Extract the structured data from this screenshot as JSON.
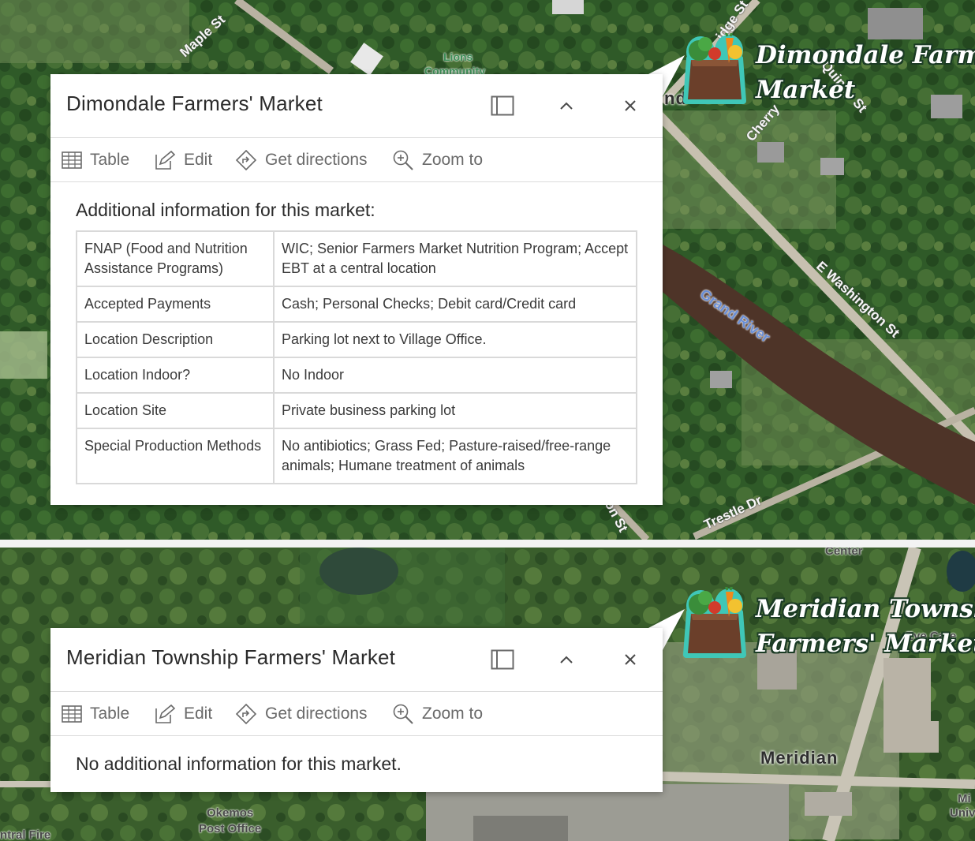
{
  "map_top": {
    "road_labels": [
      "Maple St",
      "idge St",
      "Quincy St",
      "Cherry",
      "E Washington St",
      "Trestle Dr",
      "lton St"
    ],
    "water_labels": [
      "Grand River"
    ],
    "poi_labels": [
      "Lions",
      "Community"
    ],
    "partial_place": "nd",
    "marker_label_lines": [
      "Dimondale Farmers'",
      "Market"
    ]
  },
  "popup_top": {
    "title": "Dimondale Farmers' Market",
    "toolbar": {
      "table": "Table",
      "edit": "Edit",
      "directions": "Get directions",
      "zoom": "Zoom to"
    },
    "section_title": "Additional information for this market:",
    "rows": [
      {
        "key": "FNAP (Food and Nutrition Assistance Programs)",
        "value": "WIC; Senior Farmers Market Nutrition Program; Accept EBT at a central location"
      },
      {
        "key": "Accepted Payments",
        "value": "Cash; Personal Checks; Debit card/Credit card"
      },
      {
        "key": "Location Description",
        "value": "Parking lot next to Village Office."
      },
      {
        "key": "Location Indoor?",
        "value": "No Indoor"
      },
      {
        "key": "Location Site",
        "value": "Private business parking lot"
      },
      {
        "key": "Special Production Methods",
        "value": "No antibiotics; Grass Fed; Pasture-raised/free-range animals; Humane treatment of animals"
      }
    ]
  },
  "map_bottom": {
    "place_labels": [
      "Meridian"
    ],
    "poi_labels": [
      "Center",
      "Eye Care",
      "Okemos",
      "Post Office",
      "ntral Fire",
      "Mi",
      "Univ"
    ],
    "marker_label_lines": [
      "Meridian Township",
      "Farmers' Market"
    ]
  },
  "popup_bottom": {
    "title": "Meridian Township Farmers' Market",
    "toolbar": {
      "table": "Table",
      "edit": "Edit",
      "directions": "Get directions",
      "zoom": "Zoom to"
    },
    "message": "No additional information for this market."
  },
  "colors": {
    "marker_outline": "#3fc7b7",
    "bag": "#6b3f2a",
    "popup_bg": "#ffffff",
    "table_border": "#d9d9d9"
  },
  "icons": [
    "dock-icon",
    "collapse-chevron-icon",
    "close-icon",
    "table-icon",
    "edit-icon",
    "directions-icon",
    "zoom-to-icon",
    "produce-bag-icon"
  ]
}
